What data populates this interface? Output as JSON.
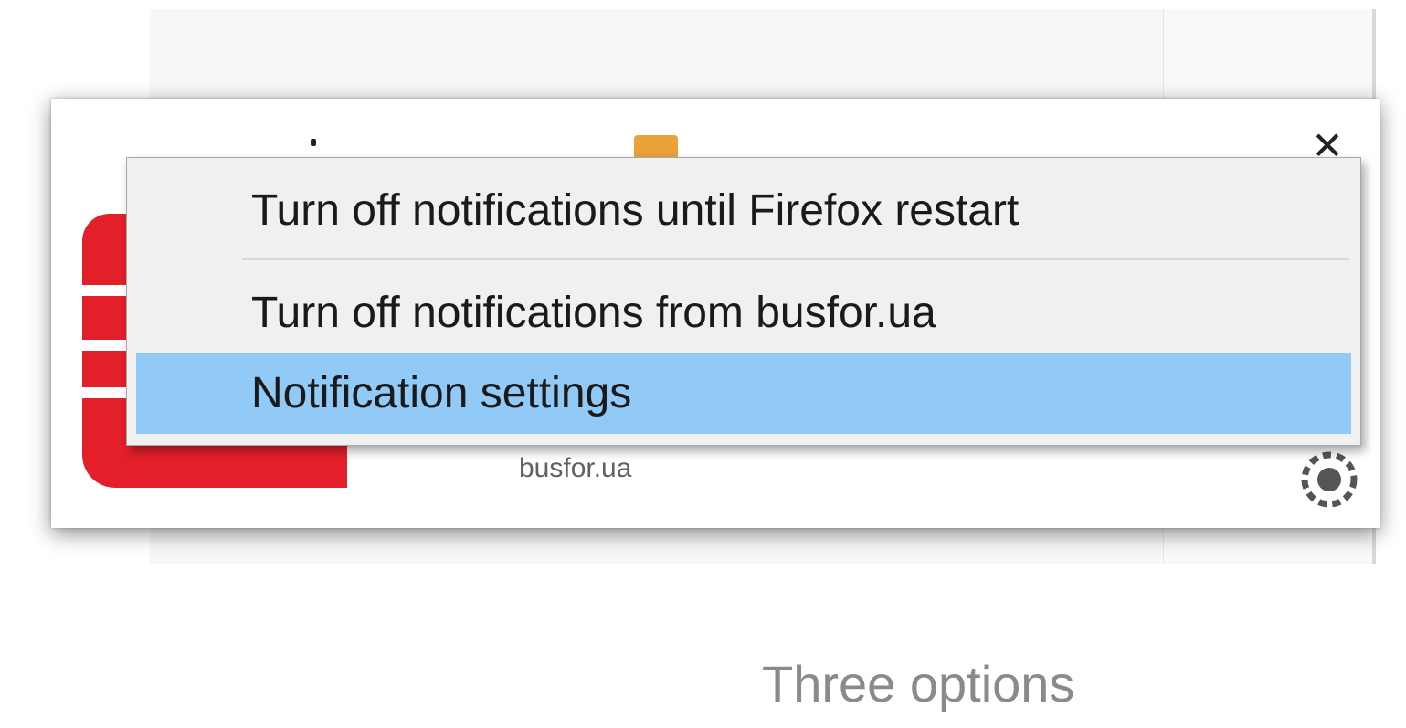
{
  "notification": {
    "origin": "busfor.ua",
    "close_glyph": "✕",
    "icons": {
      "app_icon": "busfor-logo-icon",
      "settings": "gear-icon",
      "close": "close-icon"
    }
  },
  "context_menu": {
    "items": [
      {
        "label": "Turn off notifications until Firefox restart",
        "highlighted": false
      },
      {
        "label": "Turn off notifications from busfor.ua",
        "highlighted": false
      },
      {
        "label": "Notification settings",
        "highlighted": true
      }
    ]
  },
  "caption": "Three options",
  "colors": {
    "highlight": "#91c9f7",
    "menu_bg": "#f0f0f0",
    "brand_red": "#e3202a"
  }
}
